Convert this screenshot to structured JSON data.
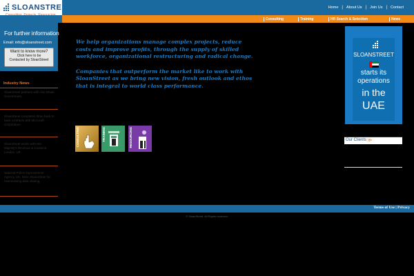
{
  "brand": {
    "name": "SLOANSTREET",
    "tagline": "Consulting. Projects. Resourcing"
  },
  "topnav": [
    {
      "label": "Home"
    },
    {
      "label": "About Us"
    },
    {
      "label": "Join Us"
    },
    {
      "label": "Contact"
    }
  ],
  "subnav": [
    {
      "label": "Consulting"
    },
    {
      "label": "Training"
    },
    {
      "label": "HR Search & Selection"
    },
    {
      "label": "News"
    }
  ],
  "sidebar": {
    "further_info": "For further information",
    "email": "Email: info@sloanstreet.com",
    "want_btn": {
      "line1": "Want to know more?",
      "line2": "Click here to be",
      "line3": "Contacted by SloanStreet"
    },
    "news_title": "Industry News",
    "news": [
      {
        "text": "SloanStreet partners with Abu Dhabi Government."
      },
      {
        "text": "SloanStreet completes three back to back contracts with Microsoft Corporation."
      },
      {
        "text": "SloanStreet works with Her Majesty's Revenue & Customs, London, UK."
      },
      {
        "text": "National Police Improvement Agency, UK, hires SloanStreet for Harmonising data sharing."
      }
    ]
  },
  "intro": {
    "p1": "We help organizations manage complex projects, reduce costs and improve profits, through the supply of skilled workforce, organizational restructuring and radical change.",
    "p2": "Companies that outperform the market like to work with SloanStreet as we bring new vision, fresh outlook and ethos that is integral to world class performance."
  },
  "services": [
    {
      "label": "CONSULTING",
      "color": "#e0a020"
    },
    {
      "label": "TRAINING",
      "color": "#3a9a6a"
    },
    {
      "label": "RESOURCING",
      "color": "#7a3aa8"
    }
  ],
  "uae_banner": {
    "brand": "SLOANSTREET",
    "line1": "starts its",
    "line2": "operations",
    "line3": "in the",
    "line4": "UAE"
  },
  "clients": {
    "label": "Our Clients",
    "arrow": "≫"
  },
  "footer": {
    "terms": "Terms of Use",
    "sep": "|",
    "privacy": "Privacy",
    "copyright": "© SloanStreet. All Rights reserved."
  },
  "colors": {
    "primary_blue": "#1a6aa0",
    "accent_orange": "#f28a1a",
    "text_blue": "#1a7ac4"
  }
}
